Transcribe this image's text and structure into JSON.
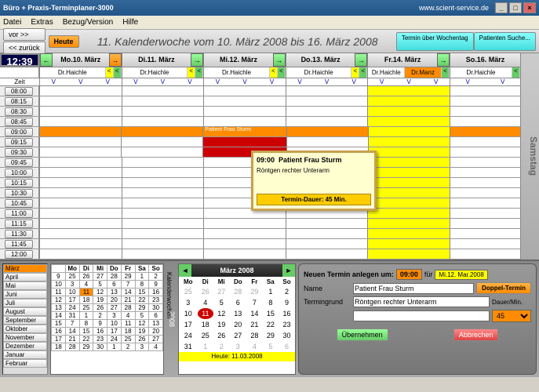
{
  "window": {
    "title": "Büro + Praxis-Terminplaner-3000",
    "url": "www.scient-service.de"
  },
  "menu": [
    "Datei",
    "Extras",
    "Bezug/Version",
    "Hilfe"
  ],
  "nav": {
    "fwd": "vor >>",
    "back": "<< zurück",
    "today": "Heute"
  },
  "weektitle": "11. Kalenderwoche vom 10. März 2008 bis 16. März 2008",
  "topbtns": {
    "terminuber": "Termin über Wochentag",
    "suche": "Patienten Suche..."
  },
  "clock": "12:39",
  "days": [
    "Mo.10. März",
    "Di.11. März",
    "Mi.12. März",
    "Do.13. März",
    "Fr.14. März",
    "So.16. März"
  ],
  "saturday": "Samstag",
  "doc1": "Dr.Haichle",
  "doc2": "Dr.Manz",
  "zeit": "Zeit",
  "times": [
    "08:00",
    "08:15",
    "08:30",
    "08:45",
    "09:00",
    "09:15",
    "09:30",
    "09:45",
    "10:00",
    "10:15",
    "10:30",
    "10:45",
    "11:00",
    "11:15",
    "11:30",
    "11:45",
    "12:00"
  ],
  "appt": {
    "label": "Patient Frau Sturm"
  },
  "tooltip": {
    "time": "09:00",
    "patient": "Patient Frau Sturm",
    "reason": "Röntgen rechter Unterarm",
    "duration": "Termin-Dauer: 45 Min."
  },
  "months": [
    "März",
    "April",
    "Mai",
    "Juni",
    "Juli",
    "August",
    "September",
    "Oktober",
    "November",
    "Dezember",
    "Januar",
    "Februar"
  ],
  "kwyear": "2008",
  "kwlabel": "Kalenderwochen",
  "minical": {
    "title": "März 2008",
    "dow": [
      "Mo",
      "Di",
      "Mi",
      "Do",
      "Fr",
      "Sa",
      "So"
    ],
    "footer": "Heute: 11.03.2008"
  },
  "newapt": {
    "title": "Neuen Termin anlegen um:",
    "time": "09:00",
    "fur": "für",
    "date": "Mi.12. Mar.2008",
    "name_lbl": "Name",
    "name": "Patient Frau Sturm",
    "doppel": "Doppel-Termin",
    "grund_lbl": "Termingrund",
    "grund": "Röntgen rechter Unterarm",
    "dauer_lbl": "Dauer/Min.",
    "dauer": "45",
    "ok": "Übernehmen",
    "cancel": "Abbrechen"
  }
}
